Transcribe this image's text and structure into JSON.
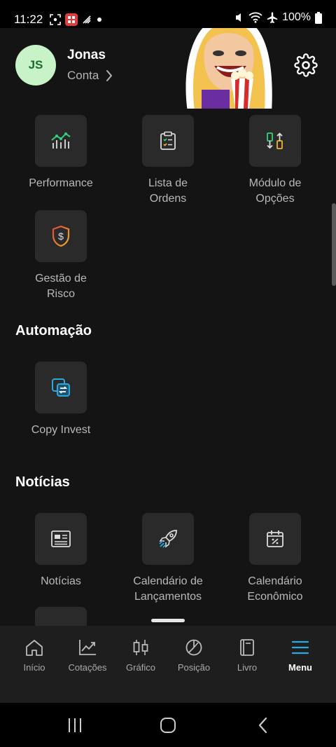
{
  "status_bar": {
    "time": "11:22",
    "battery": "100%",
    "left_icons": [
      "screenshot-icon",
      "app-icon",
      "signal-icon",
      "dot-icon"
    ],
    "right_icons": [
      "mute-icon",
      "wifi-icon",
      "airplane-icon",
      "battery-icon"
    ]
  },
  "profile": {
    "initials": "JS",
    "name": "Jonas",
    "account_link": "Conta"
  },
  "tools": [
    {
      "label_line1": "Performance",
      "label_line2": "",
      "icon": "performance-chart-icon"
    },
    {
      "label_line1": "Lista de",
      "label_line2": "Ordens",
      "icon": "order-list-icon"
    },
    {
      "label_line1": "Módulo de",
      "label_line2": "Opções",
      "icon": "options-module-icon"
    },
    {
      "label_line1": "Gestão de",
      "label_line2": "Risco",
      "icon": "risk-shield-icon"
    }
  ],
  "automation": {
    "title": "Automação",
    "items": [
      {
        "label_line1": "Copy Invest",
        "label_line2": "",
        "icon": "copy-invest-icon"
      }
    ]
  },
  "news": {
    "title": "Notícias",
    "items": [
      {
        "label_line1": "Notícias",
        "label_line2": "",
        "icon": "newspaper-icon"
      },
      {
        "label_line1": "Calendário de",
        "label_line2": "Lançamentos",
        "icon": "rocket-icon"
      },
      {
        "label_line1": "Calendário",
        "label_line2": "Econômico",
        "icon": "calendar-percent-icon"
      }
    ]
  },
  "tabbar": {
    "tabs": [
      {
        "label": "Início",
        "icon": "home-icon"
      },
      {
        "label": "Cotações",
        "icon": "quotes-icon"
      },
      {
        "label": "Gráfico",
        "icon": "candlestick-icon"
      },
      {
        "label": "Posição",
        "icon": "position-pie-icon"
      },
      {
        "label": "Livro",
        "icon": "book-icon"
      },
      {
        "label": "Menu",
        "icon": "menu-icon"
      }
    ],
    "active": "Menu"
  },
  "colors": {
    "accent": "#2aa8e0",
    "avatar_bg": "#c8f2c8",
    "avatar_text": "#1e6b2e",
    "positive": "#35d07f",
    "warning": "#f0b323",
    "danger": "#e2483a"
  }
}
